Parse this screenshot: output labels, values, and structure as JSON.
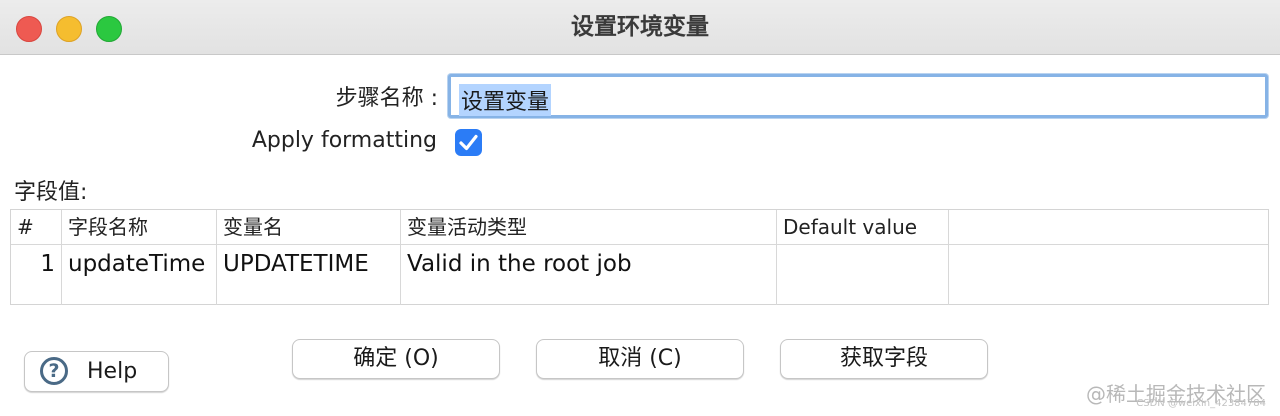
{
  "window": {
    "title": "设置环境变量"
  },
  "form": {
    "step_name_label": "步骤名称 :",
    "step_name_value": "设置变量",
    "apply_formatting_label": "Apply formatting",
    "apply_formatting_checked": true,
    "fields_label": "字段值:"
  },
  "table": {
    "columns": [
      "#",
      "字段名称",
      "变量名",
      "变量活动类型",
      "Default value",
      ""
    ],
    "rows": [
      {
        "num": "1",
        "field_name": "updateTime",
        "variable_name": "UPDATETIME",
        "scope": "Valid in the root job",
        "default_value": "",
        "extra": ""
      }
    ]
  },
  "buttons": {
    "help": "Help",
    "ok": "确定 (O)",
    "cancel": "取消 (C)",
    "get_fields": "获取字段"
  },
  "colors": {
    "accent": "#2b7cf6",
    "focus_ring": "#86b3e6",
    "selection": "#b3d4ff"
  },
  "watermark": {
    "text": "@稀土掘金技术社区",
    "sub": "CSDN @weixin_42384784"
  }
}
